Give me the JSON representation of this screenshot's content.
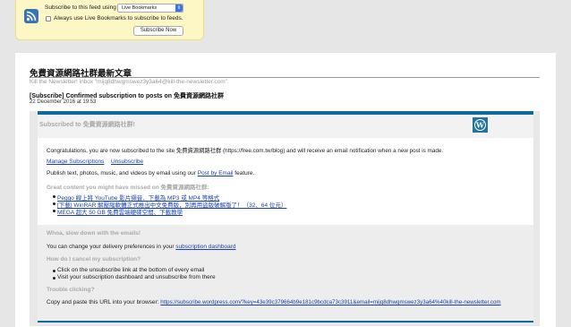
{
  "subscribe_bar": {
    "label": "Subscribe to this feed using",
    "selected_reader": "Live Bookmarks",
    "always_use_label": "Always use Live Bookmarks to subscribe to feeds.",
    "subscribe_button": "Subscribe Now"
  },
  "feed": {
    "title": "免費資源網路社群最新文章",
    "subtitle": "Kill the Newsletter! inbox “mijq8dhwgmswez3y3a64@kill-the-newsletter.com”."
  },
  "entry": {
    "title": "[Subscribe] Confirmed subscription to posts on 免費資源網路社群",
    "date": "22 December 2016 at 19:53"
  },
  "email": {
    "header_title": "Subscribed to 免費資源網路社群!",
    "congrats": "Congratulations, you are now subscribed to the site 免費資源網路社群 (https://free.com.tw/blog) and will receive an email notification when a new post is made.",
    "manage_link": "Manage Subscriptions",
    "unsubscribe_link": "Unsubscribe",
    "publish_text_before": "Publish text, photos, music, and videos by email using our ",
    "publish_link": "Post by Email",
    "publish_text_after": " feature.",
    "missed_heading": "Great content you might have missed on 免費資源網路社群:",
    "missed_items": [
      "Peggo 線上將 YouTube 影片擷音、下載為 MP3 或 MP4 等格式",
      "[下載] WinRAR 解壓縮軟體正式推出中文免費版，別再用盜版破解版了！（32、64 位元）",
      "MEGA 超大 50 GB 免費雲端硬碟空間、下載教學"
    ],
    "slow_heading": "Whoa, slow down with the emails!",
    "slow_text_before": "You can change your delivery preferences in your ",
    "dashboard_link": "subscription dashboard",
    "cancel_heading": "How do I cancel my subscription?",
    "cancel_items": [
      "Click on the unsubscribe link at the bottom of every email",
      "Visit your subscription dashboard and unsubscribe from there"
    ],
    "trouble_heading": "Trouble clicking?",
    "trouble_text": "Copy and paste this URL into your browser: ",
    "trouble_url": "https://subscribe.wordpress.com/?key=43e39c379664b9e181c9bcdca73c3911&email=mijq8dhwgmswez3y3a64%40kill-the-newsletter.com"
  },
  "colors": {
    "accent": "#0f6a9c",
    "link": "#1a3fb3",
    "subscribe_bar_bg": "#fdf7c5"
  },
  "icons": [
    "rss-feed-icon",
    "wordpress-logo-icon",
    "dropdown-arrow-icon"
  ]
}
